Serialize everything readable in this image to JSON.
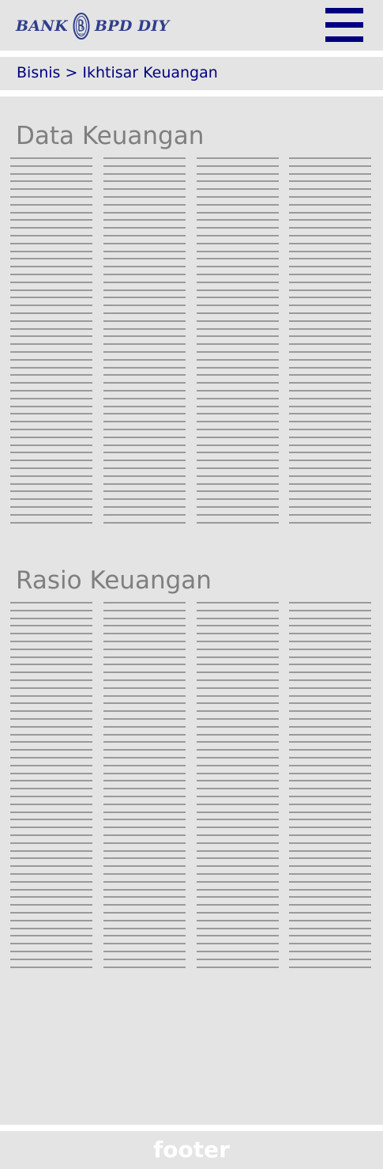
{
  "header": {
    "logo_left": "BANK",
    "logo_right": "BPD DIY",
    "menu_icon": "hamburger-menu-icon"
  },
  "breadcrumb": {
    "parent": "Bisnis",
    "separator": ">",
    "current": "Ikhtisar Keuangan"
  },
  "sections": [
    {
      "title": "Data Keuangan"
    },
    {
      "title": "Rasio Keuangan"
    }
  ],
  "footer": {
    "label": "footer"
  },
  "colors": {
    "brand": "#2f3e8c",
    "link": "#000080",
    "panel": "#e4e4e4",
    "placeholder_line": "#9a9a9a",
    "heading": "#7f7f7f"
  }
}
